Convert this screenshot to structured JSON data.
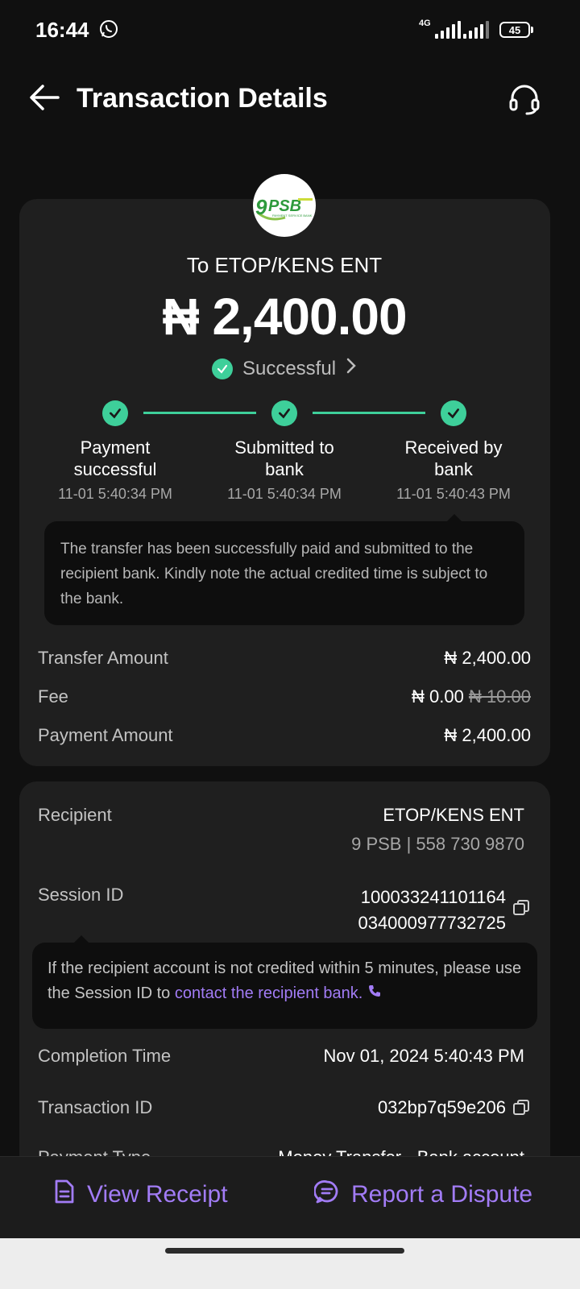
{
  "status_bar": {
    "time": "16:44",
    "network": "4G",
    "battery": "45"
  },
  "header": {
    "title": "Transaction Details"
  },
  "summary": {
    "logo_text": "9PSB",
    "logo_subtext": "PAYMENT SERVICE BANK",
    "recipient_line": "To ETOP/KENS ENT",
    "amount": "₦ 2,400.00",
    "status": "Successful"
  },
  "steps": [
    {
      "label_line1": "Payment",
      "label_line2": "successful",
      "time": "11-01 5:40:34 PM"
    },
    {
      "label_line1": "Submitted to",
      "label_line2": "bank",
      "time": "11-01 5:40:34 PM"
    },
    {
      "label_line1": "Received by",
      "label_line2": "bank",
      "time": "11-01 5:40:43 PM"
    }
  ],
  "info_tip": "The transfer has been successfully paid and submitted to the recipient bank. Kindly note the actual credited time is subject to the bank.",
  "amounts": {
    "transfer_label": "Transfer Amount",
    "transfer_value": "₦ 2,400.00",
    "fee_label": "Fee",
    "fee_value": "₦ 0.00",
    "fee_original": "₦ 10.00",
    "payment_label": "Payment Amount",
    "payment_value": "₦ 2,400.00"
  },
  "details": {
    "recipient_label": "Recipient",
    "recipient_name": "ETOP/KENS ENT",
    "recipient_bank": "9 PSB | 558 730 9870",
    "session_label": "Session ID",
    "session_line1": "100033241101164",
    "session_line2": "034000977732725",
    "session_tip_text": "If the recipient account is not credited within 5 minutes, please use the Session ID to ",
    "session_tip_link": "contact the recipient bank.",
    "completion_label": "Completion Time",
    "completion_value": "Nov 01, 2024 5:40:43 PM",
    "txid_label": "Transaction ID",
    "txid_value": "032bp7q59e206",
    "payment_type_label": "Payment Type",
    "payment_type_value": "Money Transfer - Bank account"
  },
  "actions": {
    "view_receipt": "View Receipt",
    "report_dispute": "Report a Dispute"
  },
  "colors": {
    "accent_green": "#3ecf9a",
    "accent_purple": "#a27cf6",
    "background": "#101010",
    "card": "#1f1f1f"
  }
}
